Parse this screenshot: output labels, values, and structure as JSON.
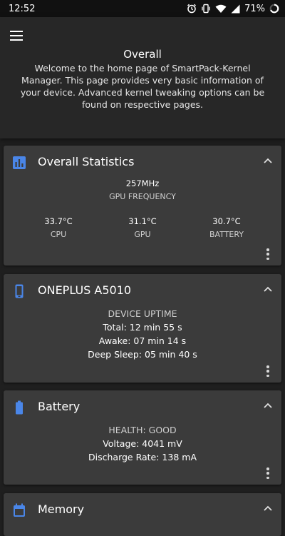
{
  "status_bar": {
    "time": "12:52",
    "battery_percent": "71%"
  },
  "header": {
    "title": "Overall",
    "description": "Welcome to the home page of SmartPack-Kernel Manager. This page provides very basic information of your device. Advanced kernel tweaking options can be found on respective pages."
  },
  "colors": {
    "accent": "#4a86e8",
    "background": "#1f1f1f",
    "card": "#3b3b3b"
  },
  "cards": {
    "overall": {
      "title": "Overall Statistics",
      "icon": "bar-chart-icon",
      "gpu_freq_value": "257MHz",
      "gpu_freq_label": "GPU FREQUENCY",
      "cpu_temp": "33.7°C",
      "cpu_label": "CPU",
      "gpu_temp": "31.1°C",
      "gpu_label": "GPU",
      "battery_temp": "30.7°C",
      "battery_label": "BATTERY"
    },
    "device": {
      "title": "ONEPLUS A5010",
      "icon": "phone-icon",
      "heading": "DEVICE UPTIME",
      "total": "Total: 12 min 55 s",
      "awake": "Awake: 07 min 14 s",
      "deep_sleep": "Deep Sleep: 05 min 40 s"
    },
    "battery": {
      "title": "Battery",
      "icon": "battery-icon",
      "health": "HEALTH: GOOD",
      "voltage": "Voltage: 4041 mV",
      "discharge": "Discharge Rate: 138 mA"
    },
    "memory": {
      "title": "Memory",
      "icon": "calendar-icon"
    }
  }
}
